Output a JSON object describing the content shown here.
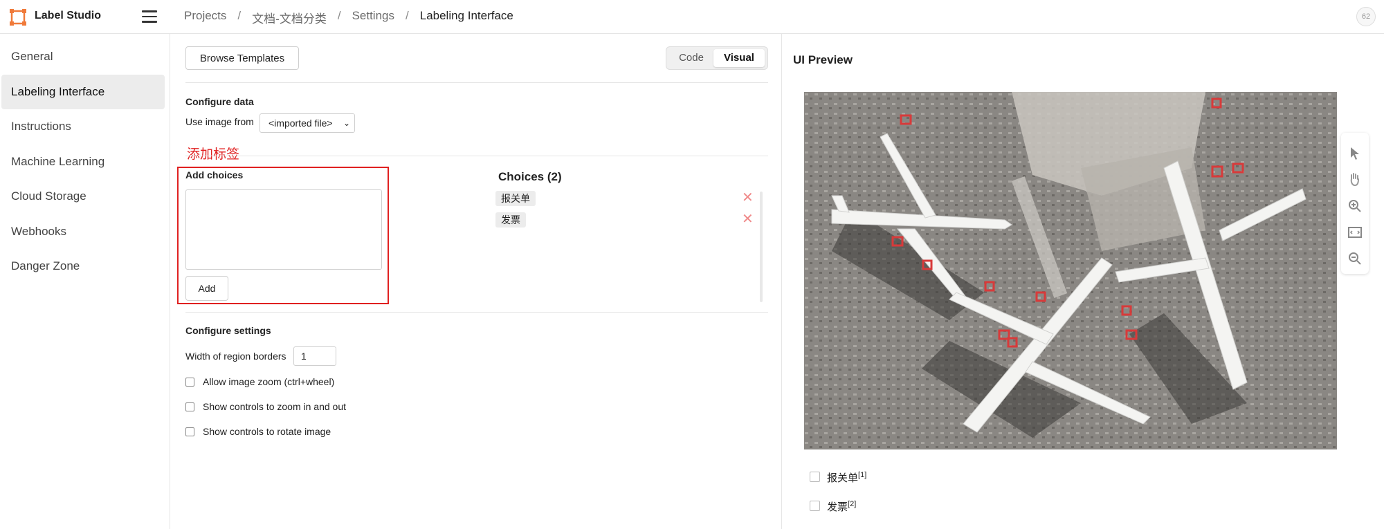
{
  "app": {
    "title": "Label Studio"
  },
  "breadcrumb": [
    "Projects",
    "文档-文档分类",
    "Settings",
    "Labeling Interface"
  ],
  "user": {
    "avatar_text": "62"
  },
  "sidebar": {
    "items": [
      {
        "label": "General"
      },
      {
        "label": "Labeling Interface",
        "active": true
      },
      {
        "label": "Instructions"
      },
      {
        "label": "Machine Learning"
      },
      {
        "label": "Cloud Storage"
      },
      {
        "label": "Webhooks"
      },
      {
        "label": "Danger Zone"
      }
    ]
  },
  "config": {
    "browse_templates": "Browse Templates",
    "mode_code": "Code",
    "mode_visual": "Visual",
    "configure_data": "Configure data",
    "use_image_from": "Use image from",
    "image_source": "<imported file>",
    "annotation_note": "添加标签",
    "add_choices": "Add choices",
    "add_choices_value": "",
    "add_button": "Add",
    "choices_title": "Choices (2)",
    "choices": [
      "报关单",
      "发票"
    ],
    "configure_settings": "Configure settings",
    "region_border_label": "Width of region borders",
    "region_border_value": "1",
    "options": [
      {
        "label": "Allow image zoom (ctrl+wheel)",
        "checked": false
      },
      {
        "label": "Show controls to zoom in and out",
        "checked": false
      },
      {
        "label": "Show controls to rotate image",
        "checked": false
      }
    ]
  },
  "preview": {
    "title": "UI Preview",
    "tools": [
      "pointer-icon",
      "hand-icon",
      "zoom-in-icon",
      "fit-icon",
      "zoom-out-icon"
    ],
    "choices": [
      {
        "label": "报关单",
        "hotkey": "[1]"
      },
      {
        "label": "发票",
        "hotkey": "[2]"
      }
    ]
  },
  "colors": {
    "accent_red": "#e02020",
    "logo_orange": "#f07a3a"
  }
}
